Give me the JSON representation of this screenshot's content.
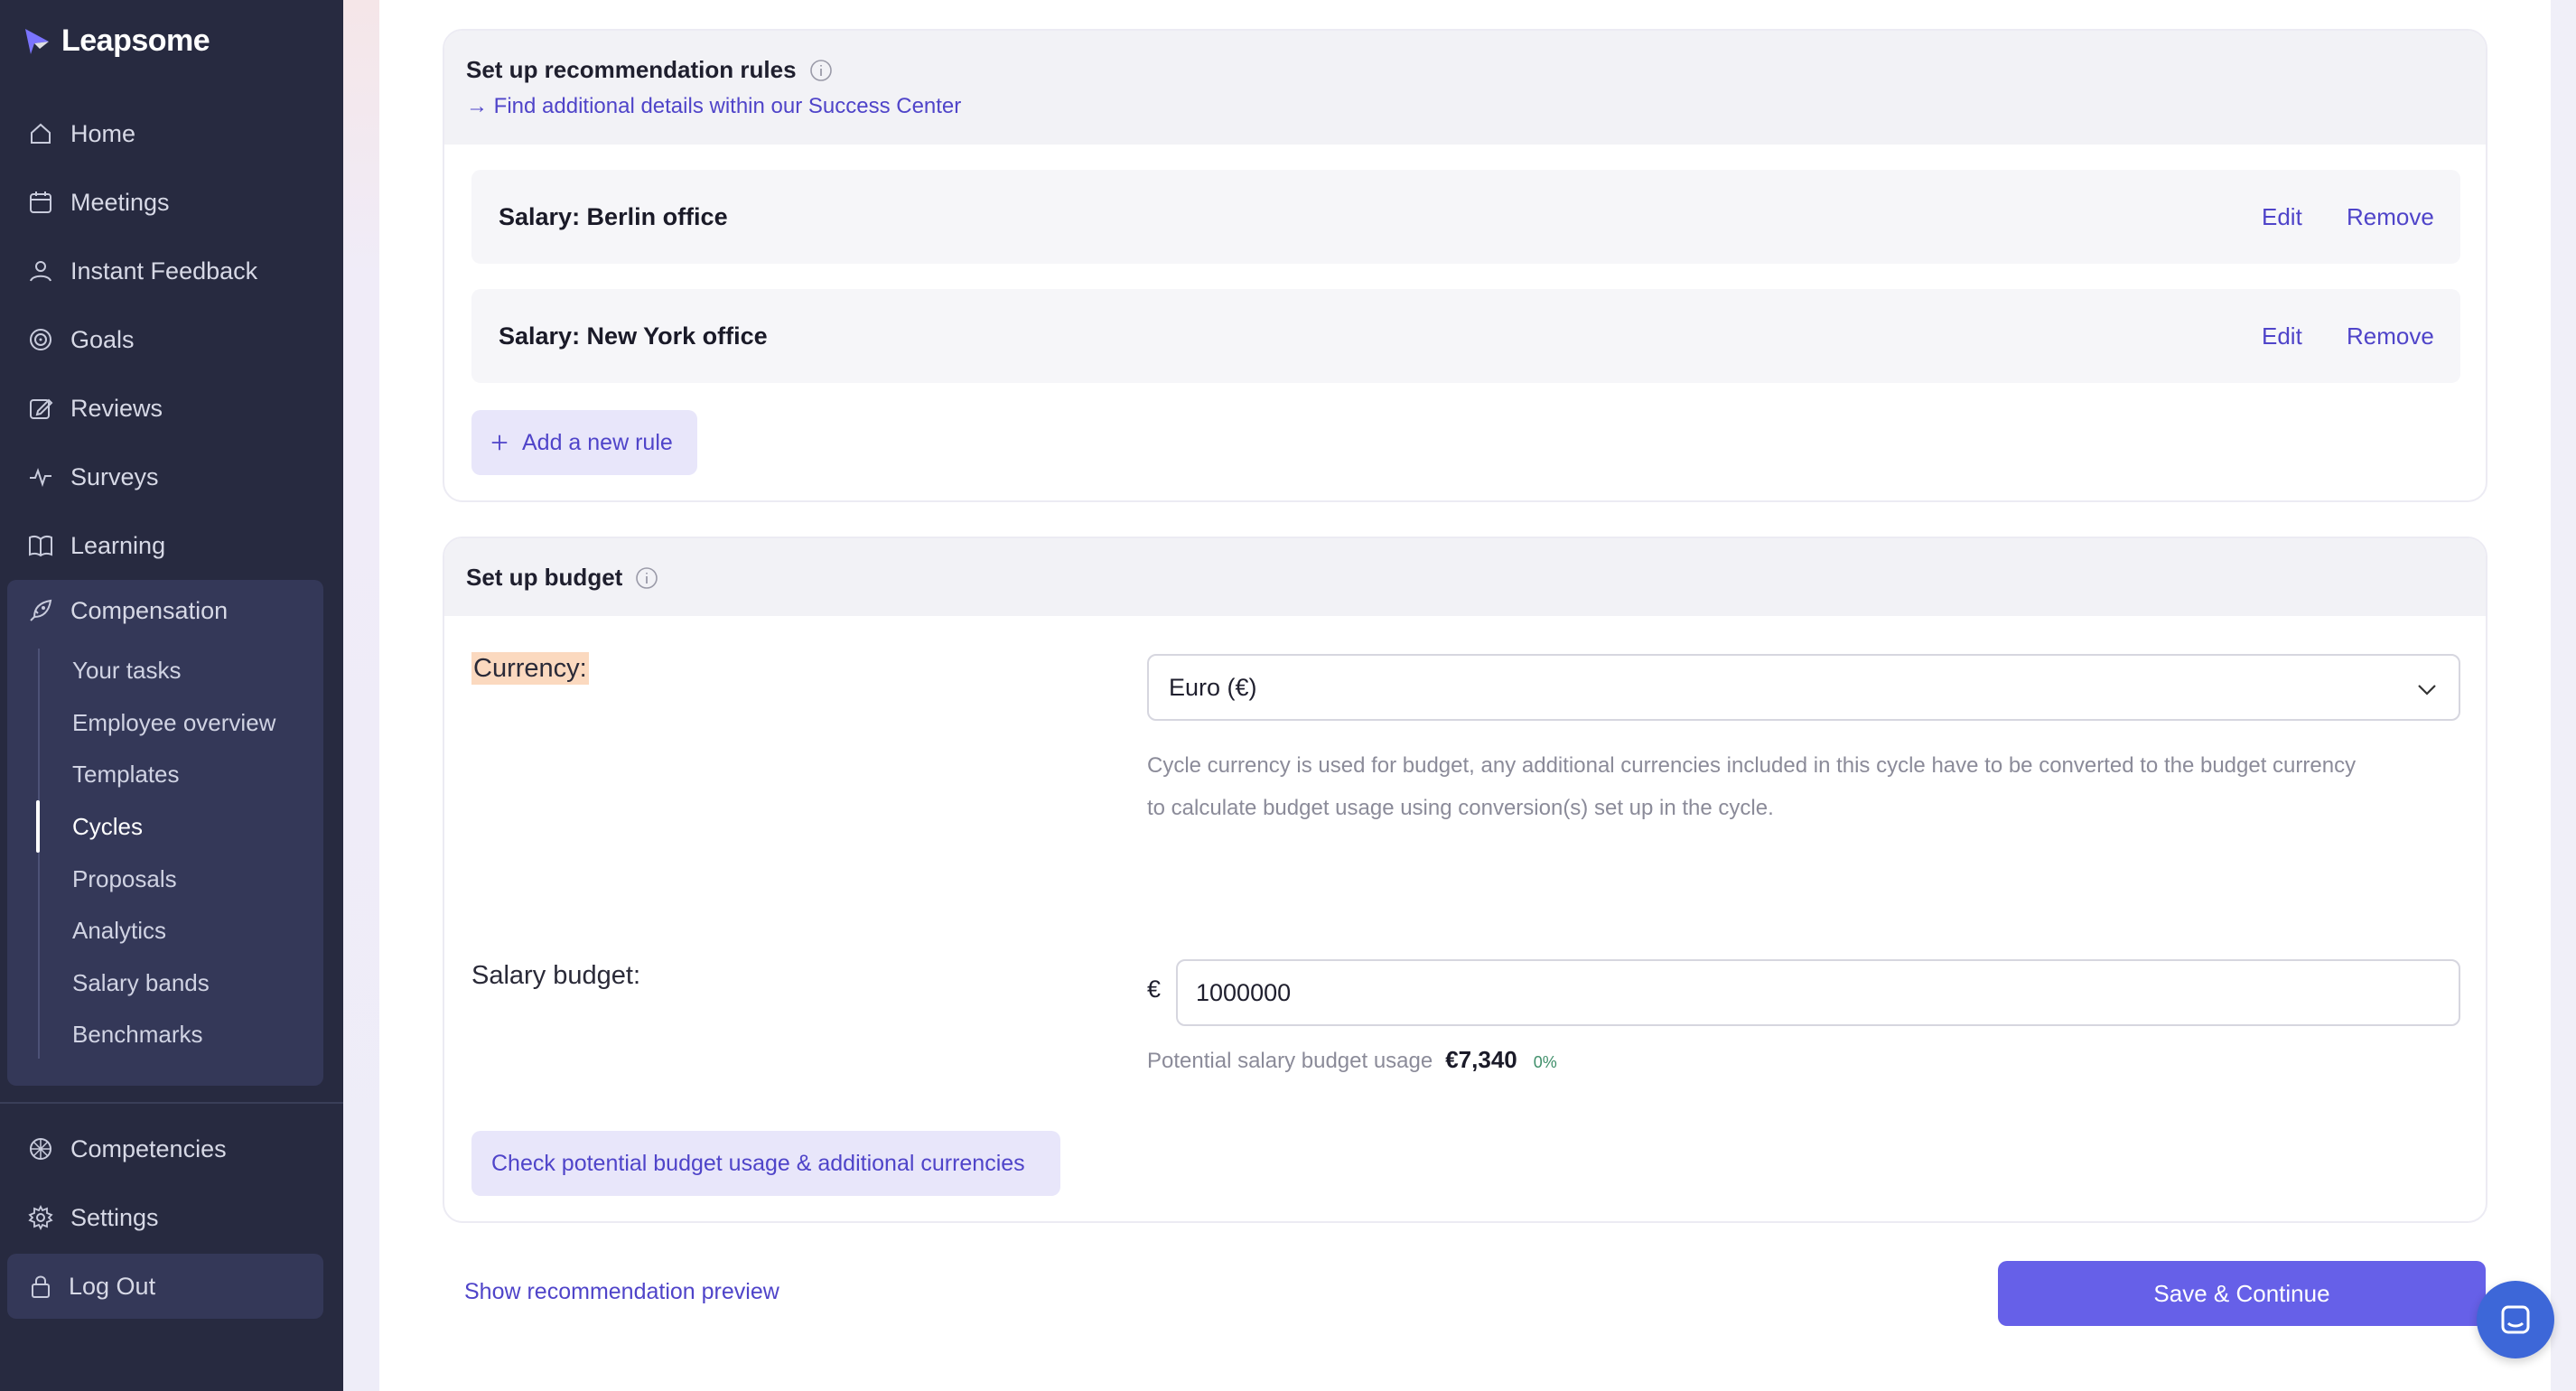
{
  "app": {
    "name": "Leapsome"
  },
  "sidebar": {
    "items": [
      {
        "label": "Home",
        "icon": "home-icon"
      },
      {
        "label": "Meetings",
        "icon": "calendar-icon"
      },
      {
        "label": "Instant Feedback",
        "icon": "feedback-icon"
      },
      {
        "label": "Goals",
        "icon": "target-icon"
      },
      {
        "label": "Reviews",
        "icon": "pencil-square-icon"
      },
      {
        "label": "Surveys",
        "icon": "pulse-icon"
      },
      {
        "label": "Learning",
        "icon": "book-icon"
      },
      {
        "label": "Compensation",
        "icon": "rocket-icon"
      }
    ],
    "compensation_sub": [
      {
        "label": "Your tasks"
      },
      {
        "label": "Employee overview"
      },
      {
        "label": "Templates"
      },
      {
        "label": "Cycles",
        "active": true
      },
      {
        "label": "Proposals"
      },
      {
        "label": "Analytics"
      },
      {
        "label": "Salary bands"
      },
      {
        "label": "Benchmarks"
      }
    ],
    "bottom_items": [
      {
        "label": "Competencies",
        "icon": "competencies-icon"
      },
      {
        "label": "Settings",
        "icon": "gear-icon"
      }
    ],
    "logout_label": "Log Out"
  },
  "rules_section": {
    "title": "Set up recommendation rules",
    "link": "→ Find additional details within our Success Center",
    "rules": [
      {
        "name": "Salary: Berlin office",
        "edit": "Edit",
        "remove": "Remove"
      },
      {
        "name": "Salary: New York office",
        "edit": "Edit",
        "remove": "Remove"
      }
    ],
    "add_rule_label": "Add a new rule"
  },
  "budget_section": {
    "title": "Set up budget",
    "currency_label": "Currency:",
    "currency_value": "Euro (€)",
    "currency_help_line1": "Cycle currency is used for budget, any additional currencies included in this cycle have to be converted to the budget currency",
    "currency_help_line2": "to calculate budget usage using conversion(s) set up in the cycle.",
    "salary_budget_label": "Salary budget:",
    "currency_symbol": "€",
    "salary_budget_value": "1000000",
    "usage_label": "Potential salary budget usage",
    "usage_value": "€7,340",
    "usage_pct": "0%",
    "check_button_label": "Check potential budget usage & additional currencies"
  },
  "footer": {
    "preview_link": "Show recommendation preview",
    "save_label": "Save & Continue"
  },
  "colors": {
    "sidebar_bg": "#272a40",
    "accent": "#6660e8",
    "link": "#4f44c9",
    "highlight": "#fbd9bf"
  }
}
